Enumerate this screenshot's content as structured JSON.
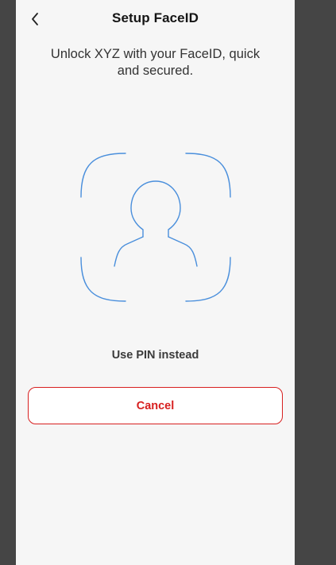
{
  "header": {
    "title": "Setup FaceID",
    "back_icon": "chevron-left-icon"
  },
  "subtitle": "Unlock XYZ with your FaceID, quick and secured.",
  "face_icon": "faceid-scan-icon",
  "actions": {
    "use_pin_label": "Use PIN instead",
    "cancel_label": "Cancel"
  },
  "colors": {
    "background": "#454545",
    "screen": "#f6f6f6",
    "faceid_stroke": "#4a8fdc",
    "danger": "#d71f1f",
    "text": "#151515"
  }
}
